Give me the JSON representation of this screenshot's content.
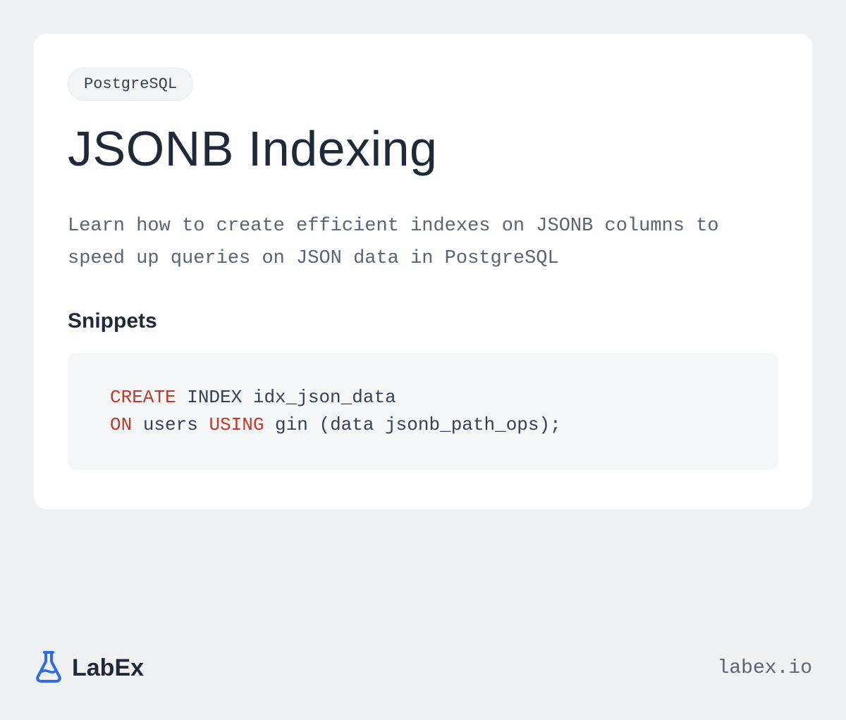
{
  "tag": "PostgreSQL",
  "title": "JSONB Indexing",
  "description": "Learn how to create efficient indexes on JSONB columns to speed up queries on JSON data in PostgreSQL",
  "snippets_heading": "Snippets",
  "code": {
    "tokens": [
      {
        "t": "CREATE",
        "kw": true
      },
      {
        "t": " INDEX idx_json_data\n",
        "kw": false
      },
      {
        "t": "ON",
        "kw": true
      },
      {
        "t": " users ",
        "kw": false
      },
      {
        "t": "USING",
        "kw": true
      },
      {
        "t": " gin (data jsonb_path_ops);",
        "kw": false
      }
    ]
  },
  "brand": {
    "name": "LabEx",
    "domain": "labex.io"
  },
  "colors": {
    "bg": "#eff1f3",
    "card": "#ffffff",
    "tag_bg": "#f3f4f6",
    "tag_border": "#e5e7eb",
    "text_primary": "#1f2937",
    "text_secondary": "#5a6472",
    "keyword": "#c0392b",
    "brand_icon": "#2e6be6"
  }
}
